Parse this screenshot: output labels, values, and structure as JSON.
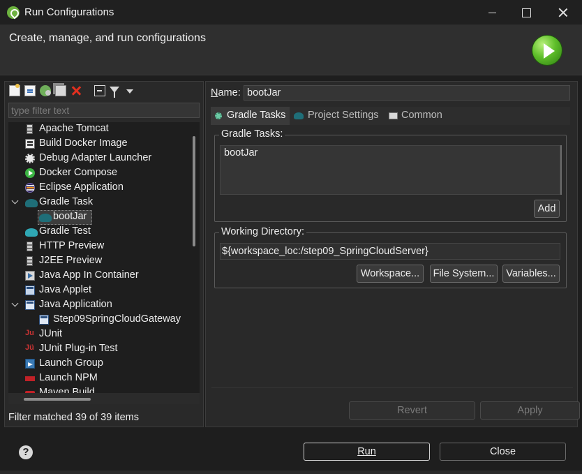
{
  "window": {
    "title": "Run Configurations"
  },
  "banner": {
    "message": "Create, manage, and run configurations"
  },
  "left": {
    "filter_placeholder": "type filter text",
    "filter_status": "Filter matched 39 of 39 items",
    "tree": [
      {
        "label": "Apache Tomcat",
        "icon": "server-icon",
        "level": 0,
        "expanded": null
      },
      {
        "label": "Build Docker Image",
        "icon": "docker-build-icon",
        "level": 0,
        "expanded": null
      },
      {
        "label": "Debug Adapter Launcher",
        "icon": "debug-adapter-icon",
        "level": 0,
        "expanded": null
      },
      {
        "label": "Docker Compose",
        "icon": "docker-compose-icon",
        "level": 0,
        "expanded": null
      },
      {
        "label": "Eclipse Application",
        "icon": "eclipse-icon",
        "level": 0,
        "expanded": null
      },
      {
        "label": "Gradle Task",
        "icon": "gradle-icon",
        "level": 0,
        "expanded": true
      },
      {
        "label": "bootJar",
        "icon": "gradle-icon",
        "level": 1,
        "expanded": null,
        "selected": true
      },
      {
        "label": "Gradle Test",
        "icon": "gradle-test-icon",
        "level": 0,
        "expanded": null
      },
      {
        "label": "HTTP Preview",
        "icon": "server-icon",
        "level": 0,
        "expanded": null
      },
      {
        "label": "J2EE Preview",
        "icon": "server-icon",
        "level": 0,
        "expanded": null
      },
      {
        "label": "Java App In Container",
        "icon": "container-icon",
        "level": 0,
        "expanded": null
      },
      {
        "label": "Java Applet",
        "icon": "applet-icon",
        "level": 0,
        "expanded": null
      },
      {
        "label": "Java Application",
        "icon": "java-app-icon",
        "level": 0,
        "expanded": true
      },
      {
        "label": "Step09SpringCloudGateway",
        "icon": "java-app-icon",
        "level": 1,
        "expanded": null
      },
      {
        "label": "JUnit",
        "icon": "junit-icon",
        "level": 0,
        "expanded": null
      },
      {
        "label": "JUnit Plug-in Test",
        "icon": "junit-plugin-icon",
        "level": 0,
        "expanded": null
      },
      {
        "label": "Launch Group",
        "icon": "launch-group-icon",
        "level": 0,
        "expanded": null
      },
      {
        "label": "Launch NPM",
        "icon": "npm-icon",
        "level": 0,
        "expanded": null
      },
      {
        "label": "Maven Build",
        "icon": "maven-icon",
        "level": 0,
        "expanded": null
      }
    ]
  },
  "right": {
    "name_label": "Name:",
    "name_value": "bootJar",
    "tabs": [
      {
        "label": "Gradle Tasks",
        "icon": "gear-icon",
        "active": true
      },
      {
        "label": "Project Settings",
        "icon": "gradle-icon",
        "active": false
      },
      {
        "label": "Common",
        "icon": "common-tab-icon",
        "active": false
      }
    ],
    "gradle_tasks": {
      "title": "Gradle Tasks:",
      "value": "bootJar",
      "add_label": "Add"
    },
    "working_dir": {
      "title": "Working Directory:",
      "value": "${workspace_loc:/step09_SpringCloudServer}",
      "workspace_label": "Workspace...",
      "filesystem_label": "File System...",
      "variables_label": "Variables..."
    },
    "revert_label": "Revert",
    "apply_label": "Apply"
  },
  "footer": {
    "help_icon": "?",
    "run_label": "Run",
    "close_label": "Close"
  }
}
